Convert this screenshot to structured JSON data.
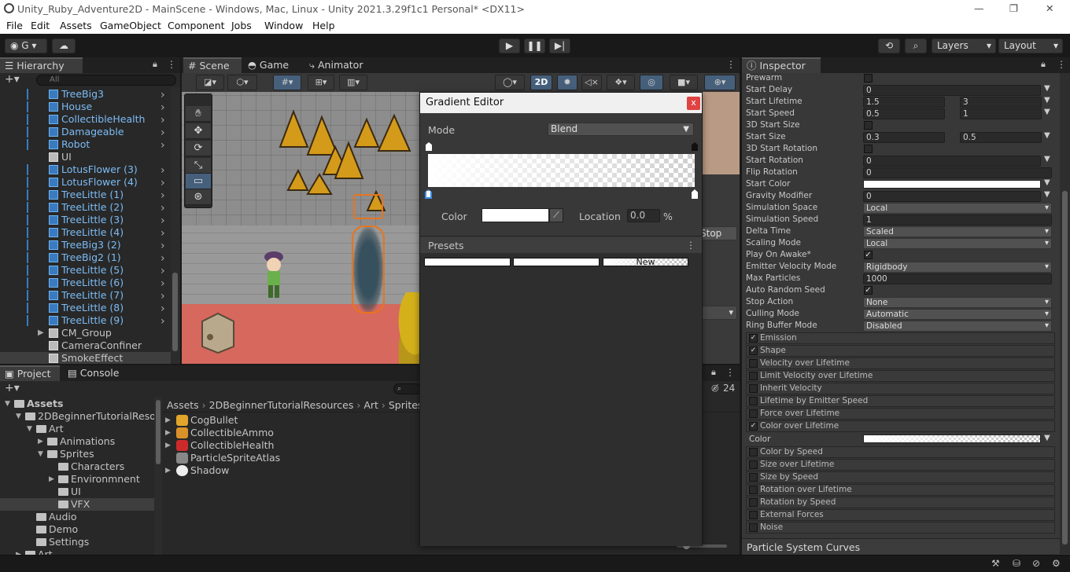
{
  "window": {
    "title": "Unity_Ruby_Adventure2D - MainScene - Windows, Mac, Linux - Unity 2021.3.29f1c1 Personal* <DX11>",
    "controls": {
      "minimize": "—",
      "maximize": "❐",
      "close": "✕"
    }
  },
  "menu": [
    "File",
    "Edit",
    "Assets",
    "GameObject",
    "Component",
    "Jobs",
    "Window",
    "Help"
  ],
  "toolbar": {
    "account_label": "G",
    "layers_label": "Layers",
    "layout_label": "Layout",
    "play_icon": "play-icon",
    "pause_icon": "pause-icon",
    "step_icon": "step-icon"
  },
  "hierarchy": {
    "tab_label": "Hierarchy",
    "search_placeholder": "All",
    "items": [
      {
        "label": "TreeBig3",
        "prefab": true
      },
      {
        "label": "House",
        "prefab": true
      },
      {
        "label": "CollectibleHealth",
        "prefab": true
      },
      {
        "label": "Damageable",
        "prefab": true
      },
      {
        "label": "Robot",
        "prefab": true
      },
      {
        "label": "UI",
        "prefab": false
      },
      {
        "label": "LotusFlower (3)",
        "prefab": true
      },
      {
        "label": "LotusFlower (4)",
        "prefab": true
      },
      {
        "label": "TreeLittle (1)",
        "prefab": true
      },
      {
        "label": "TreeLittle (2)",
        "prefab": true
      },
      {
        "label": "TreeLittle (3)",
        "prefab": true
      },
      {
        "label": "TreeLittle (4)",
        "prefab": true
      },
      {
        "label": "TreeBig3 (2)",
        "prefab": true
      },
      {
        "label": "TreeBig2 (1)",
        "prefab": true
      },
      {
        "label": "TreeLittle (5)",
        "prefab": true
      },
      {
        "label": "TreeLittle (6)",
        "prefab": true
      },
      {
        "label": "TreeLittle (7)",
        "prefab": true
      },
      {
        "label": "TreeLittle (8)",
        "prefab": true
      },
      {
        "label": "TreeLittle (9)",
        "prefab": true
      },
      {
        "label": "CM_Group",
        "prefab": false
      },
      {
        "label": "CameraConfiner",
        "prefab": false
      },
      {
        "label": "SmokeEffect",
        "prefab": false
      }
    ]
  },
  "scene_tabs": {
    "scene": "Scene",
    "game": "Game",
    "animator": "Animator",
    "mode_2d": "2D"
  },
  "scene_overlay": {
    "stop_label": "Stop",
    "visibility_count": "24"
  },
  "project": {
    "tab_project": "Project",
    "tab_console": "Console",
    "tree": [
      {
        "label": "Assets",
        "level": 0
      },
      {
        "label": "2DBeginnerTutorialResou",
        "level": 1
      },
      {
        "label": "Art",
        "level": 2
      },
      {
        "label": "Animations",
        "level": 3
      },
      {
        "label": "Sprites",
        "level": 3
      },
      {
        "label": "Characters",
        "level": 4
      },
      {
        "label": "Environmnent",
        "level": 4
      },
      {
        "label": "UI",
        "level": 4
      },
      {
        "label": "VFX",
        "level": 4
      },
      {
        "label": "Audio",
        "level": 2
      },
      {
        "label": "Demo",
        "level": 2
      },
      {
        "label": "Settings",
        "level": 2
      },
      {
        "label": "Art",
        "level": 1
      }
    ],
    "breadcrumb": [
      "Assets",
      "2DBeginnerTutorialResources",
      "Art",
      "Sprites"
    ],
    "files": [
      "CogBullet",
      "CollectibleAmmo",
      "CollectibleHealth",
      "ParticleSpriteAtlas",
      "Shadow"
    ]
  },
  "gradient_editor": {
    "title": "Gradient Editor",
    "close_label": "x",
    "mode_label": "Mode",
    "mode_value": "Blend",
    "color_label": "Color",
    "location_label": "Location",
    "location_value": "0.0",
    "location_unit": "%",
    "presets_label": "Presets",
    "new_label": "New"
  },
  "inspector": {
    "tab_label": "Inspector",
    "rows": [
      {
        "label": "Prewarm",
        "kind": "check",
        "checked": false
      },
      {
        "label": "Start Delay",
        "kind": "value",
        "values": [
          "0"
        ],
        "dd": true
      },
      {
        "label": "Start Lifetime",
        "kind": "pair",
        "values": [
          "1.5",
          "3"
        ],
        "dd": true
      },
      {
        "label": "Start Speed",
        "kind": "pair",
        "values": [
          "0.5",
          "1"
        ],
        "dd": true
      },
      {
        "label": "3D Start Size",
        "kind": "check",
        "checked": false
      },
      {
        "label": "Start Size",
        "kind": "pair",
        "values": [
          "0.3",
          "0.5"
        ],
        "dd": true
      },
      {
        "label": "3D Start Rotation",
        "kind": "check",
        "checked": false
      },
      {
        "label": "Start Rotation",
        "kind": "value",
        "values": [
          "0"
        ],
        "dd": true
      },
      {
        "label": "Flip Rotation",
        "kind": "value",
        "values": [
          "0"
        ],
        "dd": false
      },
      {
        "label": "Start Color",
        "kind": "color",
        "dd": true
      },
      {
        "label": "Gravity Modifier",
        "kind": "value",
        "values": [
          "0"
        ],
        "dd": true
      },
      {
        "label": "Simulation Space",
        "kind": "dropdown",
        "values": [
          "Local"
        ]
      },
      {
        "label": "Simulation Speed",
        "kind": "value",
        "values": [
          "1"
        ],
        "dd": false
      },
      {
        "label": "Delta Time",
        "kind": "dropdown",
        "values": [
          "Scaled"
        ]
      },
      {
        "label": "Scaling Mode",
        "kind": "dropdown",
        "values": [
          "Local"
        ]
      },
      {
        "label": "Play On Awake*",
        "kind": "check",
        "checked": true
      },
      {
        "label": "Emitter Velocity Mode",
        "kind": "dropdown",
        "values": [
          "Rigidbody"
        ]
      },
      {
        "label": "Max Particles",
        "kind": "value",
        "values": [
          "1000"
        ],
        "dd": false
      },
      {
        "label": "Auto Random Seed",
        "kind": "check",
        "checked": true
      },
      {
        "label": "Stop Action",
        "kind": "dropdown",
        "values": [
          "None"
        ]
      },
      {
        "label": "Culling Mode",
        "kind": "dropdown",
        "values": [
          "Automatic"
        ]
      },
      {
        "label": "Ring Buffer Mode",
        "kind": "dropdown",
        "values": [
          "Disabled"
        ]
      }
    ],
    "modules_a": [
      {
        "label": "Emission",
        "checked": true
      },
      {
        "label": "Shape",
        "checked": true
      },
      {
        "label": "Velocity over Lifetime",
        "checked": false
      },
      {
        "label": "Limit Velocity over Lifetime",
        "checked": false
      },
      {
        "label": "Inherit Velocity",
        "checked": false
      },
      {
        "label": "Lifetime by Emitter Speed",
        "checked": false
      },
      {
        "label": "Force over Lifetime",
        "checked": false
      },
      {
        "label": "Color over Lifetime",
        "checked": true
      }
    ],
    "color_row_label": "Color",
    "modules_b": [
      {
        "label": "Color by Speed",
        "checked": false
      },
      {
        "label": "Size over Lifetime",
        "checked": false
      },
      {
        "label": "Size by Speed",
        "checked": false
      },
      {
        "label": "Rotation over Lifetime",
        "checked": false
      },
      {
        "label": "Rotation by Speed",
        "checked": false
      },
      {
        "label": "External Forces",
        "checked": false
      },
      {
        "label": "Noise",
        "checked": false
      }
    ],
    "curves_label": "Particle System Curves"
  }
}
